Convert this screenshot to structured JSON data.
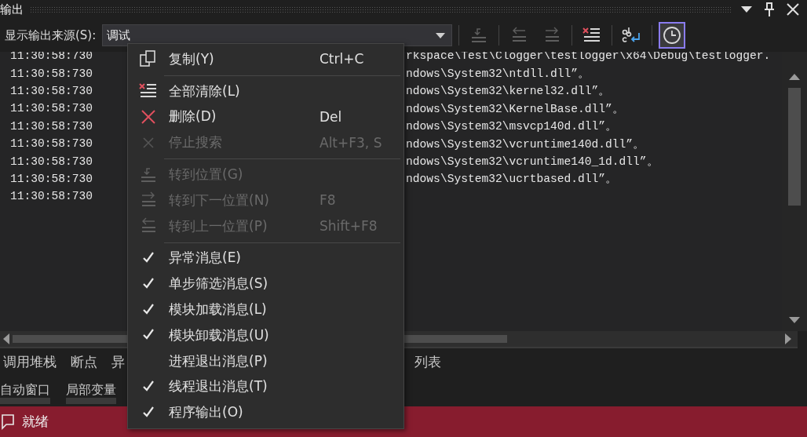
{
  "panel": {
    "title": "输出"
  },
  "toolbar": {
    "source_label": "显示输出来源(S):",
    "source_value": "调试",
    "buttons": [
      {
        "kind": "goto",
        "disabled": true,
        "selected": false
      },
      {
        "kind": "prev",
        "disabled": true,
        "selected": false
      },
      {
        "kind": "next",
        "disabled": true,
        "selected": false
      },
      {
        "kind": "clear",
        "disabled": false,
        "selected": false
      },
      {
        "kind": "wrap",
        "disabled": false,
        "selected": false
      },
      {
        "kind": "clock",
        "disabled": false,
        "selected": true
      }
    ]
  },
  "log_lines": [
    {
      "time": "11:30:58:730",
      "text": "rkspace\\Test\\Clogger\\testlogger\\x64\\Debug\\testlogger."
    },
    {
      "time": "11:30:58:730",
      "text": "ndows\\System32\\ntdll.dll”。"
    },
    {
      "time": "11:30:58:730",
      "text": "ndows\\System32\\kernel32.dll”。"
    },
    {
      "time": "11:30:58:730",
      "text": "ndows\\System32\\KernelBase.dll”。"
    },
    {
      "time": "11:30:58:730",
      "text": "ndows\\System32\\msvcp140d.dll”。"
    },
    {
      "time": "11:30:58:730",
      "text": "ndows\\System32\\vcruntime140d.dll”。"
    },
    {
      "time": "11:30:58:730",
      "text": "ndows\\System32\\vcruntime140_1d.dll”。"
    },
    {
      "time": "11:30:58:730",
      "text": "ndows\\System32\\ucrtbased.dll”。"
    },
    {
      "time": "11:30:58:730"
    }
  ],
  "tab_rows": [
    [
      {
        "label": "调用堆栈"
      },
      {
        "label": "断点"
      },
      {
        "label": "异"
      },
      {
        "label": "列表",
        "after_menu": true
      }
    ],
    [
      {
        "label": "自动窗口"
      },
      {
        "label": "局部变量"
      }
    ]
  ],
  "context_menu": {
    "items": [
      {
        "kind": "copy",
        "label": "复制(Y)",
        "shortcut": "Ctrl+C",
        "disabled": false,
        "separator_after": true
      },
      {
        "kind": "clear",
        "label": "全部清除(L)",
        "disabled": false
      },
      {
        "kind": "delete",
        "label": "删除(D)",
        "shortcut": "Del",
        "disabled": false
      },
      {
        "kind": "stop",
        "label": "停止搜索",
        "shortcut": "Alt+F3, S",
        "disabled": true,
        "separator_after": true
      },
      {
        "kind": "goto",
        "label": "转到位置(G)",
        "disabled": true
      },
      {
        "kind": "next",
        "label": "转到下一位置(N)",
        "shortcut": "F8",
        "disabled": true
      },
      {
        "kind": "prev",
        "label": "转到上一位置(P)",
        "shortcut": "Shift+F8",
        "disabled": true,
        "separator_after": true
      },
      {
        "kind": "toggle",
        "label": "异常消息(E)",
        "checked": true
      },
      {
        "kind": "toggle",
        "label": "单步筛选消息(S)",
        "checked": true
      },
      {
        "kind": "toggle",
        "label": "模块加载消息(L)",
        "checked": true
      },
      {
        "kind": "toggle",
        "label": "模块卸载消息(U)",
        "checked": true
      },
      {
        "kind": "toggle",
        "label": "进程退出消息(P)",
        "checked": false
      },
      {
        "kind": "toggle",
        "label": "线程退出消息(T)",
        "checked": true
      },
      {
        "kind": "toggle",
        "label": "程序输出(O)",
        "checked": true
      }
    ]
  },
  "status_bar": {
    "text": "就绪"
  }
}
